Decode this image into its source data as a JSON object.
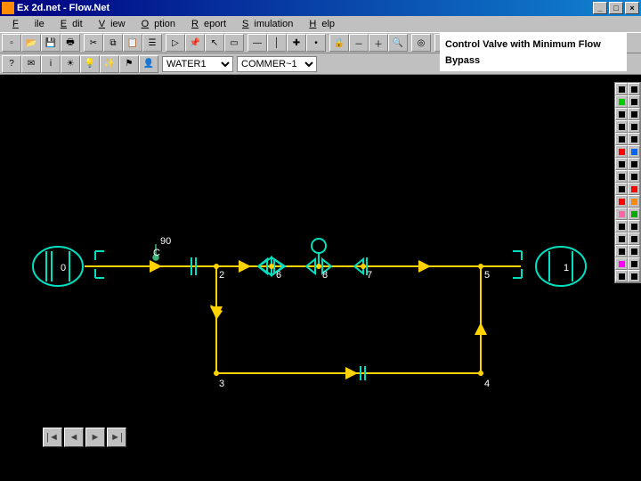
{
  "title": "Ex 2d.net - Flow.Net",
  "menu": {
    "items": [
      "File",
      "Edit",
      "View",
      "Option",
      "Report",
      "Simulation",
      "Help"
    ]
  },
  "toolbar1": {
    "icons": [
      "new-file",
      "open-file",
      "save",
      "print",
      "cut",
      "copy",
      "paste",
      "tree",
      "play",
      "pushpin",
      "pointer",
      "select-box",
      "hline",
      "vline",
      "pipe-cross",
      "node",
      "zoom-lock",
      "zoom-out",
      "zoom-in",
      "find",
      "target",
      "stop"
    ]
  },
  "toolbar2": {
    "icons": [
      "help",
      "tip",
      "info",
      "sun",
      "bulb",
      "wand",
      "flag",
      "person"
    ],
    "combo1": {
      "value": "WATER1"
    },
    "combo2": {
      "value": "COMMER~1"
    }
  },
  "annotation": {
    "text": "Control Valve with Minimum Flow Bypass"
  },
  "palette": {
    "rows": [
      [
        "arrow",
        "square"
      ],
      [
        "circle-green",
        "N"
      ],
      [
        "pipe",
        "valve"
      ],
      [
        "cv",
        "pump"
      ],
      [
        "tee",
        "tank"
      ],
      [
        "burst-red",
        "burst-blue"
      ],
      [
        "comp",
        "omega"
      ],
      [
        "wave",
        "blank"
      ],
      [
        "curve",
        "red-up"
      ],
      [
        "red-sq",
        "orange"
      ],
      [
        "pink",
        "green-x"
      ],
      [
        "tank2",
        "hx"
      ],
      [
        "split",
        "mix"
      ],
      [
        "chart",
        "end"
      ],
      [
        "flag-p",
        "blank2"
      ],
      [
        "bars",
        "blank3"
      ]
    ]
  },
  "diagram": {
    "nodes": [
      {
        "id": "0",
        "label": "0"
      },
      {
        "id": "2",
        "label": "2"
      },
      {
        "id": "6",
        "label": "6"
      },
      {
        "id": "8",
        "label": "8"
      },
      {
        "id": "7",
        "label": "7"
      },
      {
        "id": "5",
        "label": "5"
      },
      {
        "id": "1",
        "label": "1"
      },
      {
        "id": "3",
        "label": "3"
      },
      {
        "id": "4",
        "label": "4"
      }
    ],
    "annotations": {
      "temp": "90",
      "temp_unit": "C"
    },
    "colors": {
      "pump": "#00e0c0",
      "pipe": "#ffd200",
      "arrow": "#ffd200",
      "label": "#ffffff",
      "accent": "#3cb371"
    }
  },
  "nav": {
    "buttons": [
      "first",
      "prev",
      "next",
      "last"
    ]
  }
}
